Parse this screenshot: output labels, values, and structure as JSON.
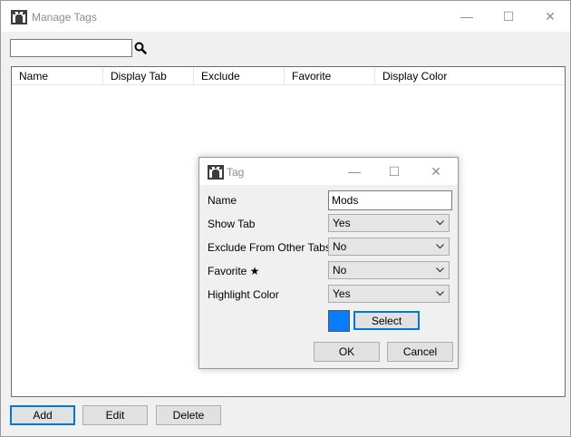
{
  "main": {
    "title": "Manage Tags",
    "search": {
      "value": "",
      "placeholder": ""
    },
    "columns": [
      "Name",
      "Display Tab",
      "Exclude",
      "Favorite",
      "Display Color"
    ],
    "buttons": {
      "add": "Add",
      "edit": "Edit",
      "delete": "Delete"
    }
  },
  "window_controls": {
    "minimize": "—",
    "maximize": "☐",
    "close": "✕"
  },
  "dialog": {
    "title": "Tag",
    "fields": {
      "name": {
        "label": "Name",
        "value": "Mods"
      },
      "show_tab": {
        "label": "Show Tab",
        "value": "Yes"
      },
      "exclude": {
        "label": "Exclude From Other Tabs",
        "value": "No"
      },
      "favorite": {
        "label": "Favorite ★",
        "value": "No"
      },
      "highlight": {
        "label": "Highlight Color",
        "value": "Yes"
      }
    },
    "color": {
      "hex": "#0a7cff",
      "select_label": "Select"
    },
    "buttons": {
      "ok": "OK",
      "cancel": "Cancel"
    }
  },
  "icons": [
    "app-icon",
    "search-icon",
    "chevron-down-icon"
  ]
}
